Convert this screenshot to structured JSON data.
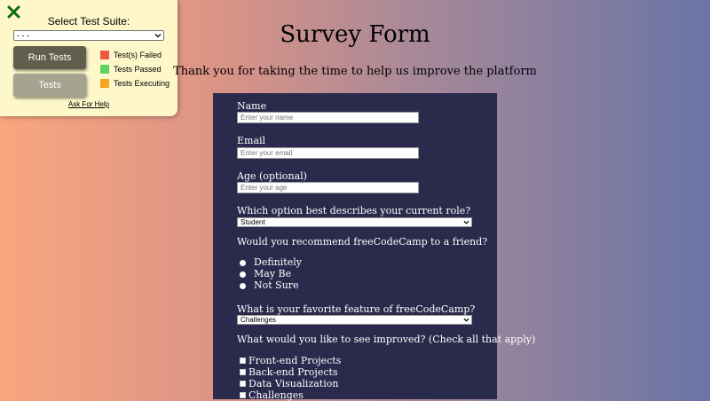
{
  "test_panel": {
    "label": "Select Test Suite:",
    "suite_value": "- - -",
    "run_button": "Run Tests",
    "tests_button": "Tests",
    "legend": [
      {
        "label": "Test(s) Failed",
        "color": "#f0573f"
      },
      {
        "label": "Tests Passed",
        "color": "#5ed35e"
      },
      {
        "label": "Tests Executing",
        "color": "#f5a51b"
      }
    ],
    "help_link": "Ask For Help",
    "close_color": "#0c6b0c"
  },
  "page": {
    "title": "Survey Form",
    "description": "Thank you for taking the time to help us improve the platform"
  },
  "form": {
    "name_label": "Name",
    "name_placeholder": "Enter your name",
    "email_label": "Email",
    "email_placeholder": "Enter your email",
    "age_label": "Age (optional)",
    "age_placeholder": "Enter your age",
    "role_label": "Which option best describes your current role?",
    "role_value": "Student",
    "recommend_label": "Would you recommend freeCodeCamp to a friend?",
    "recommend_options": [
      "Definitely",
      "May Be",
      "Not Sure"
    ],
    "feature_label": "What is your favorite feature of freeCodeCamp?",
    "feature_value": "Challenges",
    "improve_label": "What would you like to see improved? (Check all that apply)",
    "improve_options": [
      "Front-end Projects",
      "Back-end Projects",
      "Data Visualization",
      "Challenges"
    ]
  }
}
